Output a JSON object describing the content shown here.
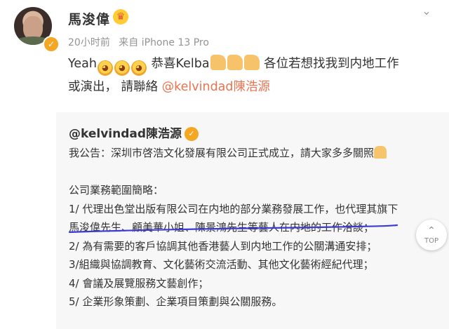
{
  "post": {
    "username": "馬浚偉",
    "crown_icon": "crown-badge-icon",
    "verified_icon": "verified-badge-icon",
    "time": "20小时前",
    "source": "来自 iPhone 13 Pro",
    "more_icon": "chevron-down-icon",
    "text_start": "Yeah",
    "text_congrats": " 恭喜Kelba",
    "text_after_thumbs": " 各位若想找我到内地工作",
    "text_line2": "或演出， 請聯絡 ",
    "mention": "@kelvindad陳浩源"
  },
  "repost": {
    "author": "@kelvindad陳浩源",
    "lines": [
      "我公告：深圳市啓浩文化發展有限公司正式成立，請大家多多關照",
      "",
      "公司業務範圍簡略：",
      "1/ 代理出色堂出版有限公司在内地的部分業務發展工作，也代理其旗下",
      "馬浚偉先生、顧美華小姐、陳景鴻先生等藝人在内地的工作洽談；",
      "2/ 為有需要的客戶協調其他香港藝人到内地工作的公關溝通安排；",
      "3/組織與協調教育、文化藝術交流活動、其他文化藝術經紀代理；",
      "4/ 會議及展覽服務文藝創作；",
      "5/ 企業形象策劃、企業項目策劃與公關服務。"
    ]
  },
  "scroll_top": {
    "label": "TOP"
  },
  "colors": {
    "accent": "#eb7350",
    "underline": "#3b3bd6",
    "verified": "#f5a623"
  }
}
